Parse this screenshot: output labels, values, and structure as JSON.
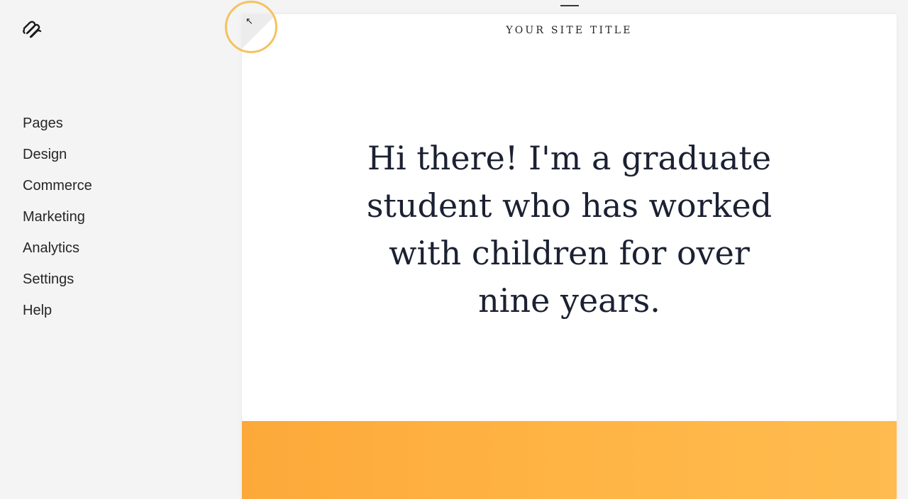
{
  "sidebar": {
    "logo_icon": "squarespace-logo-icon",
    "items": [
      {
        "label": "Pages"
      },
      {
        "label": "Design"
      },
      {
        "label": "Commerce"
      },
      {
        "label": "Marketing"
      },
      {
        "label": "Analytics"
      },
      {
        "label": "Settings"
      },
      {
        "label": "Help"
      }
    ]
  },
  "preview": {
    "site_title": "YOUR SITE TITLE",
    "intro_text": "Hi there! I'm a graduate student who has worked with children for over nine years.",
    "banner_color": "#ffb444",
    "collapse_icon": "arrow-up-left-icon",
    "collapse_symbol": "↖"
  },
  "colors": {
    "sidebar_bg": "#f4f4f4",
    "highlight_ring": "#f5c260",
    "heading_text": "#1b2132"
  }
}
